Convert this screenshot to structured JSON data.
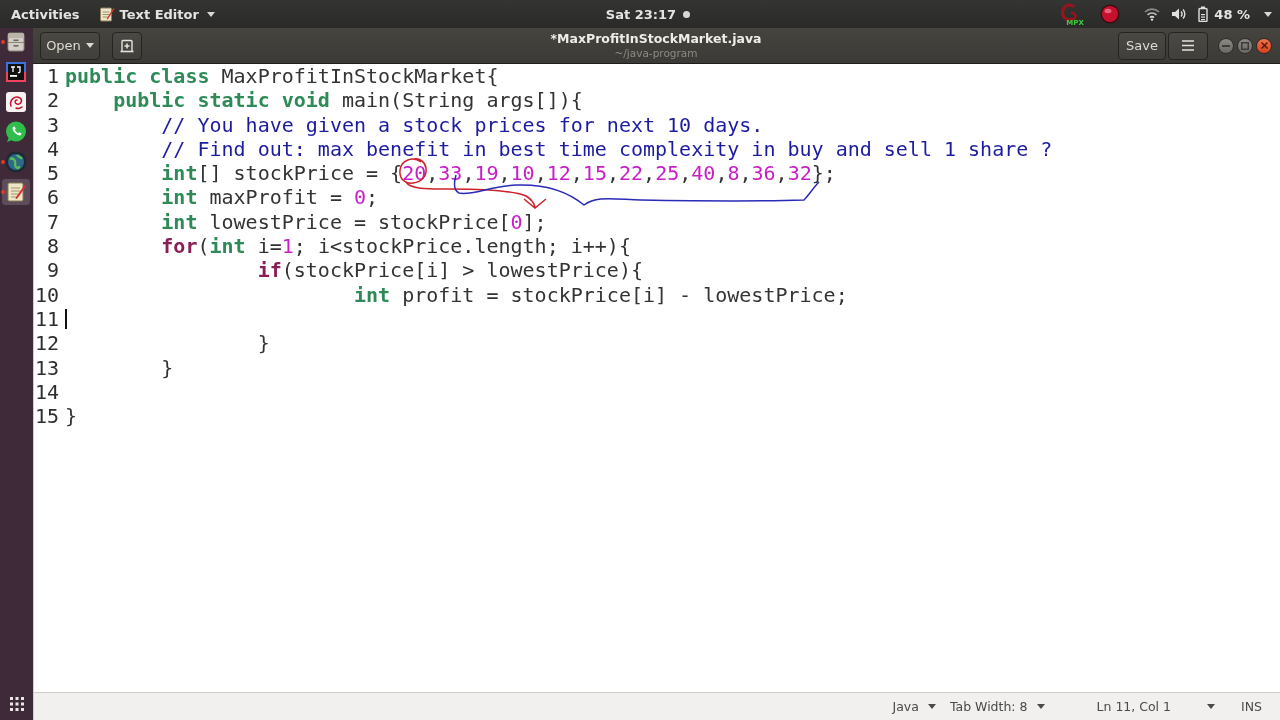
{
  "top_bar": {
    "activities": "Activities",
    "app_menu": "Text Editor",
    "clock": "Sat 23:17",
    "notification": true,
    "tray_label": "MPX",
    "battery": "48 %"
  },
  "dock": {
    "apps": [
      {
        "kind": "cabinet",
        "running": true,
        "selected": false
      },
      {
        "kind": "ide",
        "running": false,
        "selected": false
      },
      {
        "kind": "letter",
        "running": false,
        "selected": false
      },
      {
        "kind": "chat",
        "running": false,
        "selected": false
      },
      {
        "kind": "globe",
        "running": true,
        "selected": false
      },
      {
        "kind": "notepad",
        "running": true,
        "selected": true
      }
    ]
  },
  "header_bar": {
    "open_button": "Open",
    "title": "*MaxProfitInStockMarket.java",
    "subtitle": "~/java-program",
    "save_button": "Save"
  },
  "editor": {
    "lines": [
      {
        "number": "1",
        "cursor": false,
        "tokens": [
          {
            "kind": "keyword",
            "text": "public class"
          },
          {
            "kind": "plain",
            "text": " MaxProfitInStockMarket{"
          }
        ],
        "children": [
          {
            "number": "2",
            "cursor": false,
            "tokens": [
              {
                "kind": "keyword",
                "text": "public static void"
              },
              {
                "kind": "plain",
                "text": " main(String args[]){"
              }
            ],
            "children": [
              {
                "number": "3",
                "cursor": false,
                "tokens": [
                  {
                    "kind": "comment",
                    "text": "// You have given a stock prices for next 10 days."
                  }
                ]
              },
              {
                "number": "4",
                "cursor": false,
                "tokens": [
                  {
                    "kind": "comment",
                    "text": "// Find out: max benefit in best time complexity in buy and sell 1 share ?"
                  }
                ]
              },
              {
                "number": "5",
                "cursor": false,
                "tokens": [
                  {
                    "kind": "keyword",
                    "text": "int"
                  },
                  {
                    "kind": "plain",
                    "text": "[] stockPrice = {"
                  },
                  {
                    "kind": "number",
                    "text": "20"
                  },
                  {
                    "kind": "plain",
                    "text": ","
                  },
                  {
                    "kind": "number",
                    "text": "33"
                  },
                  {
                    "kind": "plain",
                    "text": ","
                  },
                  {
                    "kind": "number",
                    "text": "19"
                  },
                  {
                    "kind": "plain",
                    "text": ","
                  },
                  {
                    "kind": "number",
                    "text": "10"
                  },
                  {
                    "kind": "plain",
                    "text": ","
                  },
                  {
                    "kind": "number",
                    "text": "12"
                  },
                  {
                    "kind": "plain",
                    "text": ","
                  },
                  {
                    "kind": "number",
                    "text": "15"
                  },
                  {
                    "kind": "plain",
                    "text": ","
                  },
                  {
                    "kind": "number",
                    "text": "22"
                  },
                  {
                    "kind": "plain",
                    "text": ","
                  },
                  {
                    "kind": "number",
                    "text": "25"
                  },
                  {
                    "kind": "plain",
                    "text": ","
                  },
                  {
                    "kind": "number",
                    "text": "40"
                  },
                  {
                    "kind": "plain",
                    "text": ","
                  },
                  {
                    "kind": "number",
                    "text": "8"
                  },
                  {
                    "kind": "plain",
                    "text": ","
                  },
                  {
                    "kind": "number",
                    "text": "36"
                  },
                  {
                    "kind": "plain",
                    "text": ","
                  },
                  {
                    "kind": "number",
                    "text": "32"
                  },
                  {
                    "kind": "plain",
                    "text": "};"
                  }
                ]
              },
              {
                "number": "6",
                "cursor": false,
                "tokens": [
                  {
                    "kind": "keyword",
                    "text": "int"
                  },
                  {
                    "kind": "plain",
                    "text": " maxProfit = "
                  },
                  {
                    "kind": "number",
                    "text": "0"
                  },
                  {
                    "kind": "plain",
                    "text": ";"
                  }
                ]
              },
              {
                "number": "7",
                "cursor": false,
                "tokens": [
                  {
                    "kind": "keyword",
                    "text": "int"
                  },
                  {
                    "kind": "plain",
                    "text": " lowestPrice = stockPrice["
                  },
                  {
                    "kind": "number",
                    "text": "0"
                  },
                  {
                    "kind": "plain",
                    "text": "];"
                  }
                ]
              },
              {
                "number": "8",
                "cursor": false,
                "tokens": [
                  {
                    "kind": "control",
                    "text": "for"
                  },
                  {
                    "kind": "plain",
                    "text": "("
                  },
                  {
                    "kind": "keyword",
                    "text": "int"
                  },
                  {
                    "kind": "plain",
                    "text": " i="
                  },
                  {
                    "kind": "number",
                    "text": "1"
                  },
                  {
                    "kind": "plain",
                    "text": "; i<stockPrice.length; i++){"
                  }
                ],
                "children": [
                  {
                    "number": "9",
                    "cursor": false,
                    "tokens": [
                      {
                        "kind": "control",
                        "text": "if"
                      },
                      {
                        "kind": "plain",
                        "text": "(stockPrice[i] > lowestPrice){"
                      }
                    ],
                    "children": [
                      {
                        "number": "10",
                        "cursor": false,
                        "tokens": [
                          {
                            "kind": "keyword",
                            "text": "int"
                          },
                          {
                            "kind": "plain",
                            "text": " profit = stockPrice[i] - lowestPrice;"
                          }
                        ]
                      },
                      {
                        "number": "11",
                        "cursor": true
                      }
                    ]
                  },
                  {
                    "number": "12",
                    "cursor": false,
                    "tokens": [
                      {
                        "kind": "plain",
                        "text": "}"
                      }
                    ]
                  }
                ]
              },
              {
                "number": "13",
                "cursor": false,
                "tokens": [
                  {
                    "kind": "plain",
                    "text": "}"
                  }
                ]
              },
              {
                "number": "14",
                "cursor": false
              }
            ]
          }
        ]
      },
      {
        "number": "15",
        "cursor": false,
        "tokens": [
          {
            "kind": "plain",
            "text": "}"
          }
        ]
      }
    ]
  },
  "status_bar": {
    "language": "Java",
    "tab_width": "Tab Width: 8",
    "position": "Ln 11, Col 1",
    "mode": "INS"
  }
}
